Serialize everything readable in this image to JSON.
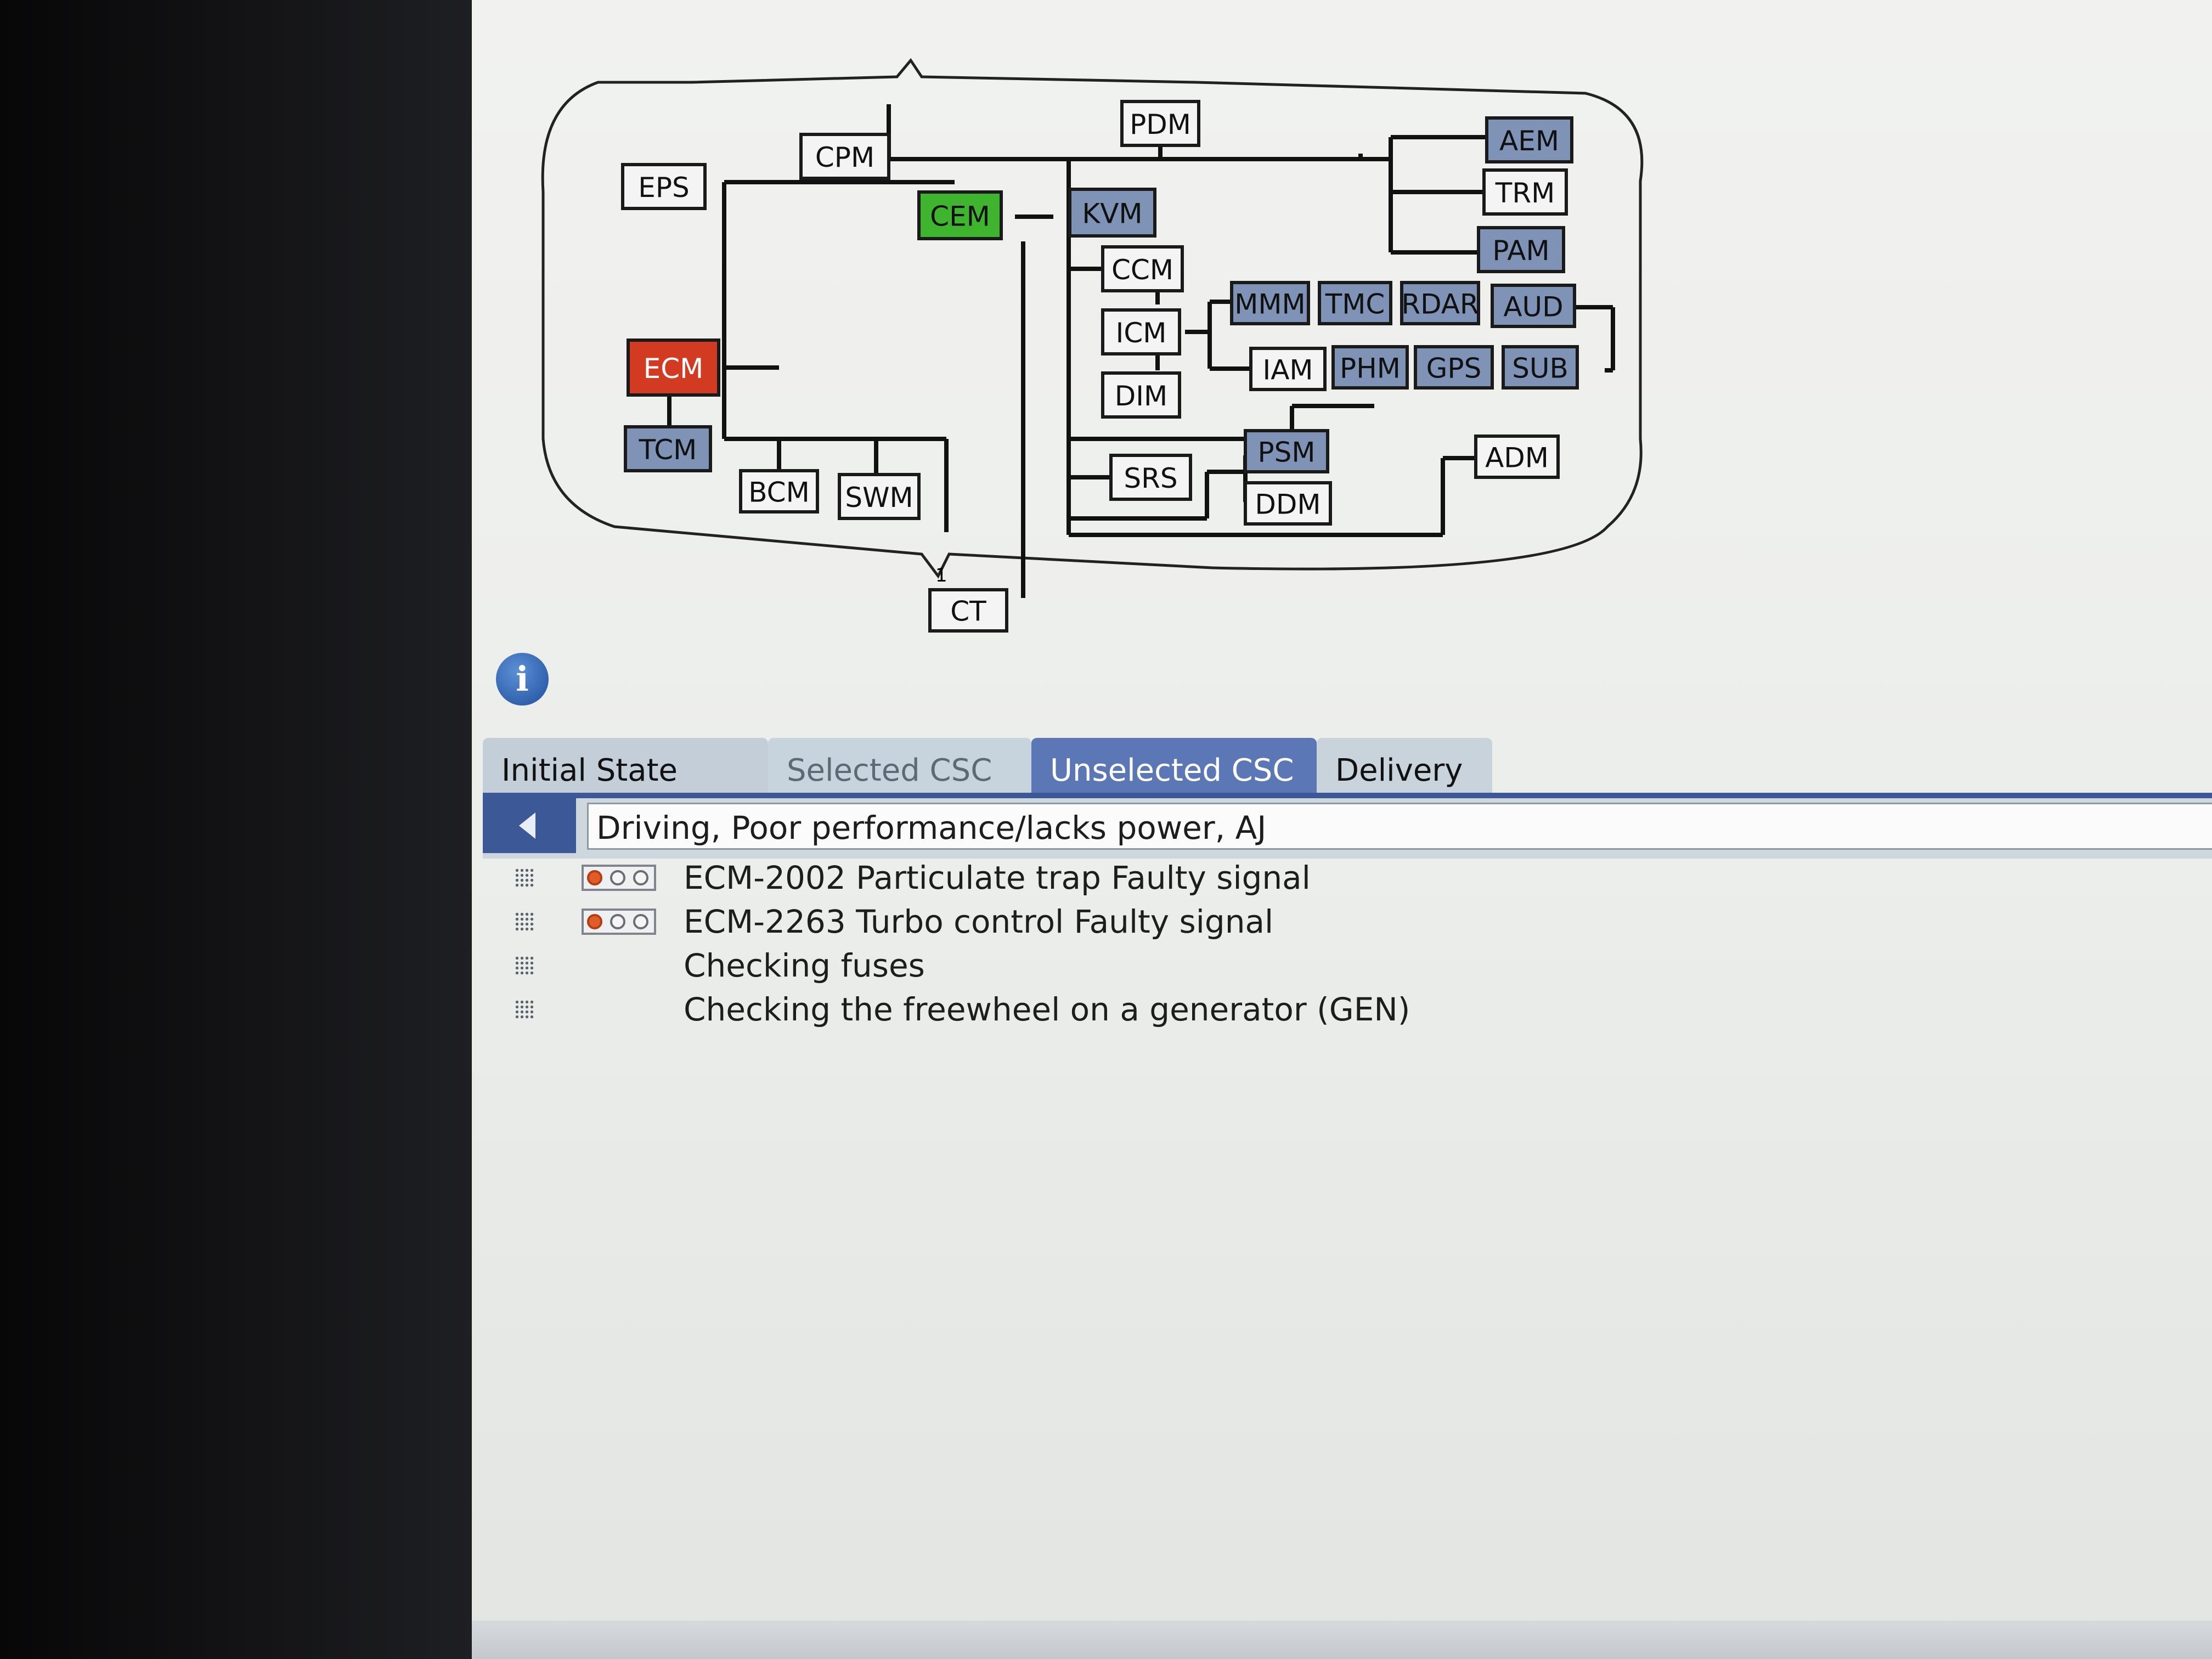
{
  "network": {
    "nodes": [
      {
        "id": "PDM",
        "label": "PDM",
        "state": "normal"
      },
      {
        "id": "CPM",
        "label": "CPM",
        "state": "normal"
      },
      {
        "id": "EPS",
        "label": "EPS",
        "state": "normal"
      },
      {
        "id": "CEM",
        "label": "CEM",
        "state": "ok"
      },
      {
        "id": "KVM",
        "label": "KVM",
        "state": "present"
      },
      {
        "id": "AEM",
        "label": "AEM",
        "state": "present"
      },
      {
        "id": "TRM",
        "label": "TRM",
        "state": "normal"
      },
      {
        "id": "PAM",
        "label": "PAM",
        "state": "present"
      },
      {
        "id": "CCM",
        "label": "CCM",
        "state": "normal"
      },
      {
        "id": "ICM",
        "label": "ICM",
        "state": "normal"
      },
      {
        "id": "DIM",
        "label": "DIM",
        "state": "normal"
      },
      {
        "id": "MMM",
        "label": "MMM",
        "state": "present"
      },
      {
        "id": "TMC",
        "label": "TMC",
        "state": "present"
      },
      {
        "id": "RDAR",
        "label": "RDAR",
        "state": "present"
      },
      {
        "id": "AUD",
        "label": "AUD",
        "state": "present"
      },
      {
        "id": "IAM",
        "label": "IAM",
        "state": "normal"
      },
      {
        "id": "PHM",
        "label": "PHM",
        "state": "present"
      },
      {
        "id": "GPS",
        "label": "GPS",
        "state": "present"
      },
      {
        "id": "SUB",
        "label": "SUB",
        "state": "present"
      },
      {
        "id": "ECM",
        "label": "ECM",
        "state": "fault"
      },
      {
        "id": "TCM",
        "label": "TCM",
        "state": "present"
      },
      {
        "id": "BCM",
        "label": "BCM",
        "state": "normal"
      },
      {
        "id": "SWM",
        "label": "SWM",
        "state": "normal"
      },
      {
        "id": "SRS",
        "label": "SRS",
        "state": "normal"
      },
      {
        "id": "PSM",
        "label": "PSM",
        "state": "present"
      },
      {
        "id": "DDM",
        "label": "DDM",
        "state": "normal"
      },
      {
        "id": "ADM",
        "label": "ADM",
        "state": "normal"
      },
      {
        "id": "CT",
        "label": "CT",
        "state": "normal"
      }
    ],
    "connector_pin": "1"
  },
  "colors": {
    "ok": "#3fb52f",
    "fault": "#d23a22",
    "present": "#7f93b6",
    "normal": "#f4f4f4",
    "accent": "#3d5896"
  },
  "icons": {
    "info": "info-icon",
    "back": "left-triangle-icon",
    "grip": "grip-icon",
    "dtc_status": "status-lights-icon"
  },
  "tabs": [
    {
      "label": "Initial State",
      "active": false
    },
    {
      "label": "Selected CSC",
      "active": false
    },
    {
      "label": "Unselected CSC",
      "active": true
    },
    {
      "label": "Delivery",
      "active": false
    }
  ],
  "context": {
    "value": "Driving, Poor performance/lacks power, AJ"
  },
  "results": [
    {
      "text": "ECM-2002 Particulate trap Faulty signal",
      "has_status": true
    },
    {
      "text": "ECM-2263 Turbo control Faulty signal",
      "has_status": true
    },
    {
      "text": "Checking fuses",
      "has_status": false
    },
    {
      "text": "Checking the freewheel on a generator (GEN)",
      "has_status": false
    }
  ],
  "info_glyph": "i"
}
